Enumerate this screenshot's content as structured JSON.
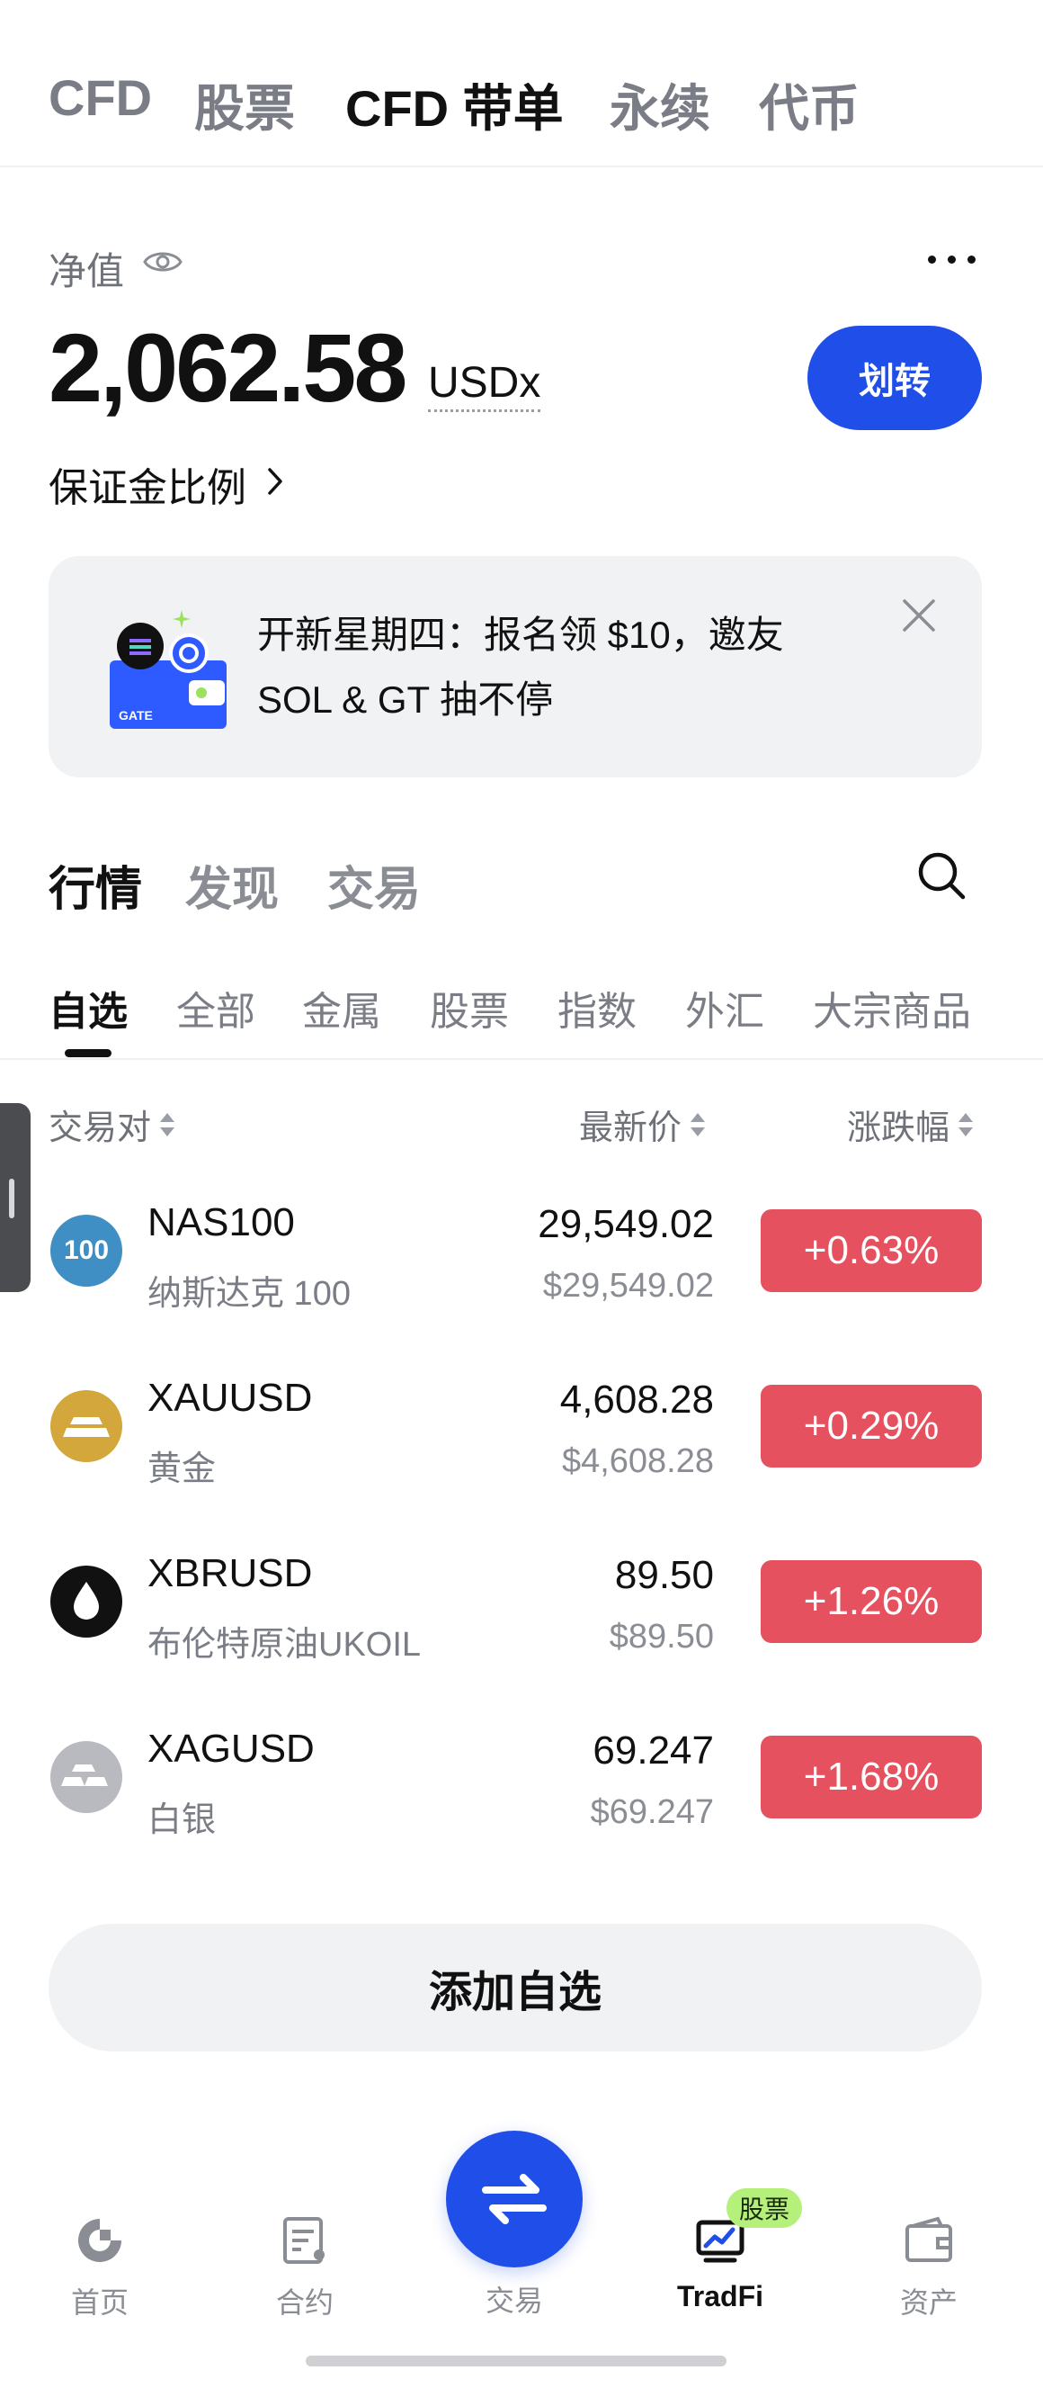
{
  "top_tabs": [
    "CFD",
    "股票",
    "CFD 带单",
    "永续",
    "代币"
  ],
  "account": {
    "net_value_label": "净值",
    "balance": "2,062.58",
    "currency": "USDx",
    "transfer_label": "划转",
    "margin_ratio_label": "保证金比例"
  },
  "banner": {
    "line1": "开新星期四：报名领 $10，邀友",
    "line2": "SOL & GT 抽不停",
    "logo_text": "GATE"
  },
  "section_tabs": [
    "行情",
    "发现",
    "交易"
  ],
  "category_tabs": [
    "自选",
    "全部",
    "金属",
    "股票",
    "指数",
    "外汇",
    "大宗商品"
  ],
  "table_header": {
    "pair": "交易对",
    "last_price": "最新价",
    "change": "涨跌幅"
  },
  "rows": [
    {
      "symbol": "NAS100",
      "name": "纳斯达克 100",
      "price": "29,549.02",
      "price_usd": "$29,549.02",
      "change": "+0.63%",
      "icon_text": "100",
      "icon_color": "#3f8fc4"
    },
    {
      "symbol": "XAUUSD",
      "name": "黄金",
      "price": "4,608.28",
      "price_usd": "$4,608.28",
      "change": "+0.29%",
      "icon_color": "#d4a73c"
    },
    {
      "symbol": "XBRUSD",
      "name": "布伦特原油UKOIL",
      "price": "89.50",
      "price_usd": "$89.50",
      "change": "+1.26%",
      "icon_color": "#111111"
    },
    {
      "symbol": "XAGUSD",
      "name": "白银",
      "price": "69.247",
      "price_usd": "$69.247",
      "change": "+1.68%",
      "icon_color": "#b9bac0"
    }
  ],
  "add_watchlist_label": "添加自选",
  "bottom_nav": {
    "home": "首页",
    "contract": "合约",
    "trade": "交易",
    "tradfi": "TradFi",
    "assets": "资产",
    "tradfi_badge": "股票"
  },
  "colors": {
    "accent": "#1f4fe8",
    "up": "#e5515e",
    "badge": "#b4f07a"
  }
}
